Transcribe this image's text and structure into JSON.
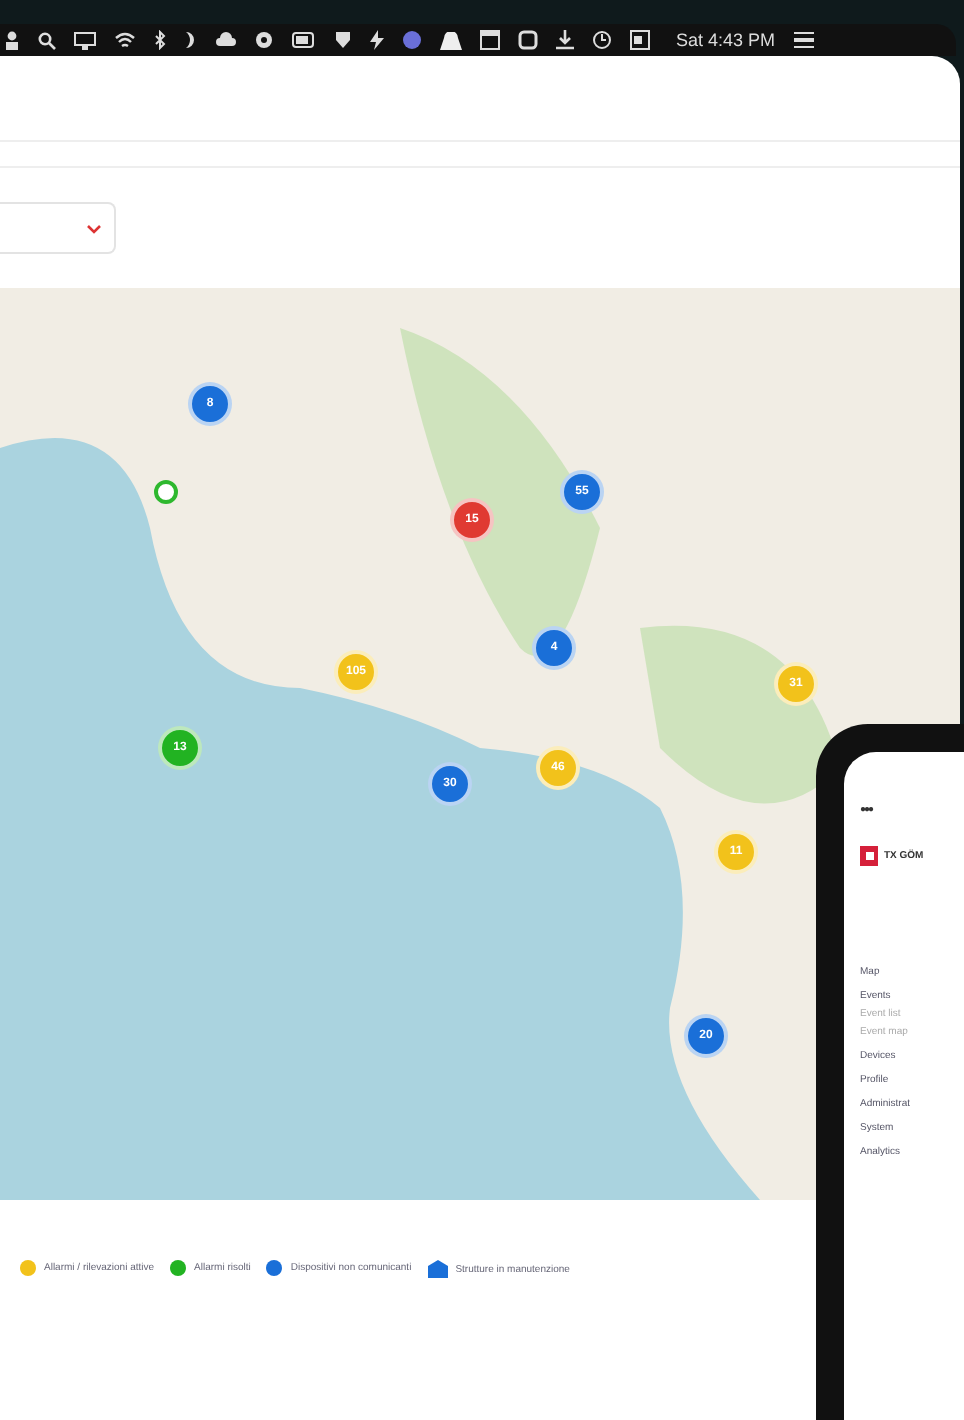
{
  "menu_bar": {
    "clock": "Sat 4:43 PM"
  },
  "map": {
    "markers": [
      {
        "count": "8",
        "color": "#1a6fd8"
      },
      {
        "color": "#2eb82e",
        "kind": "ring"
      },
      {
        "count": "15",
        "color": "#e03a32"
      },
      {
        "count": "55",
        "color": "#1a6fd8"
      },
      {
        "count": "4",
        "color": "#1a6fd8"
      },
      {
        "count": "105",
        "color": "#f2c21b"
      },
      {
        "count": "31",
        "color": "#f2c21b"
      },
      {
        "count": "13",
        "color": "#22b322"
      },
      {
        "count": "30",
        "color": "#1a6fd8"
      },
      {
        "count": "46",
        "color": "#f2c21b"
      },
      {
        "count": "11",
        "color": "#f2c21b"
      },
      {
        "count": "20",
        "color": "#1a6fd8"
      }
    ]
  },
  "legend": [
    {
      "kind": "dot",
      "label": "Allarmi / rilevazioni attive",
      "color": "#f2c21b"
    },
    {
      "kind": "dot",
      "label": "Allarmi risolti",
      "color": "#22b322"
    },
    {
      "kind": "dot",
      "label": "Dispositivi non comunicanti",
      "color": "#1a6fd8"
    },
    {
      "kind": "building",
      "label": "Strutture in manutenzione",
      "color": "#1a6fd8"
    }
  ],
  "phone": {
    "dots": "●●●",
    "brand": "TX GÖM",
    "menu": [
      {
        "label": "Map",
        "sub": false
      },
      {
        "label": "Events",
        "sub": false
      },
      {
        "label": "Event list",
        "sub": true
      },
      {
        "label": "Event map",
        "sub": true
      },
      {
        "label": "Devices",
        "sub": false
      },
      {
        "label": "Profile",
        "sub": false
      },
      {
        "label": "Administrat",
        "sub": false
      },
      {
        "label": "System",
        "sub": false
      },
      {
        "label": "Analytics",
        "sub": false
      }
    ]
  }
}
